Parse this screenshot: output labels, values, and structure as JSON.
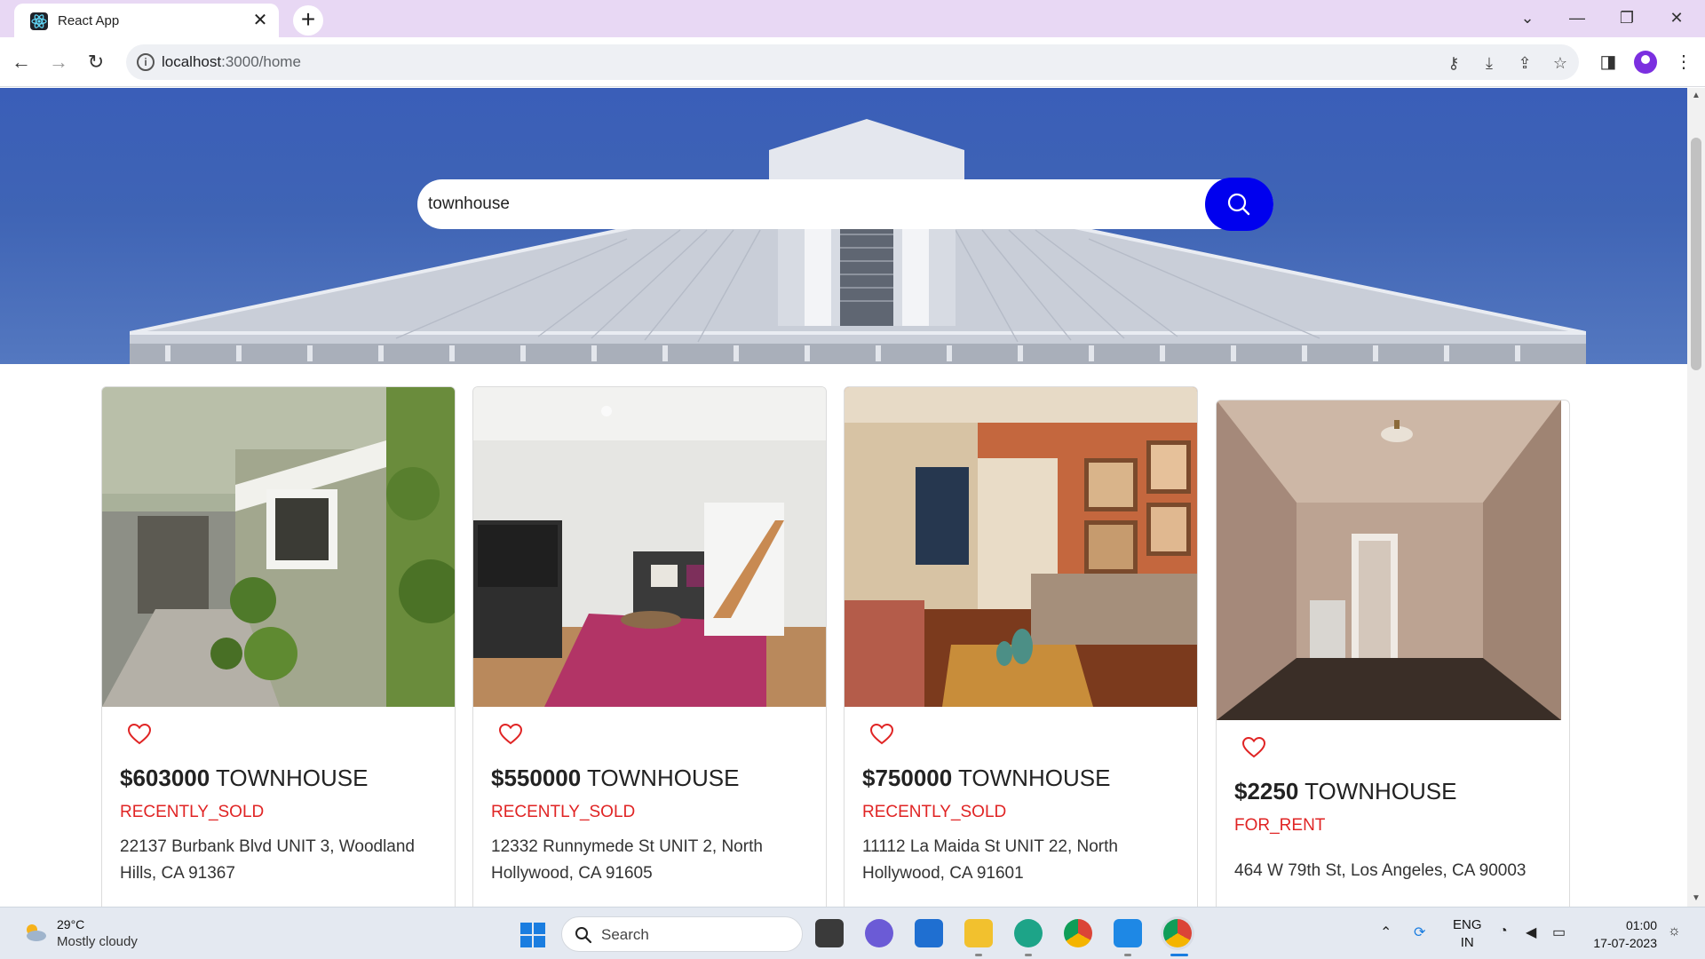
{
  "browser": {
    "tab_title": "React App",
    "url_host": "localhost",
    "url_rest": ":3000/home"
  },
  "search": {
    "value": "townhouse"
  },
  "listings": [
    {
      "price": "$603000",
      "type": "TOWNHOUSE",
      "status": "RECENTLY_SOLD",
      "address": "22137 Burbank Blvd UNIT 3, Woodland Hills, CA 91367"
    },
    {
      "price": "$550000",
      "type": "TOWNHOUSE",
      "status": "RECENTLY_SOLD",
      "address": "12332 Runnymede St UNIT 2, North Hollywood, CA 91605"
    },
    {
      "price": "$750000",
      "type": "TOWNHOUSE",
      "status": "RECENTLY_SOLD",
      "address": "11112 La Maida St UNIT 22, North Hollywood, CA 91601"
    },
    {
      "price": "$2250",
      "type": "TOWNHOUSE",
      "status": "FOR_RENT",
      "address": "464 W 79th St, Los Angeles, CA 90003"
    }
  ],
  "taskbar": {
    "weather_temp": "29°C",
    "weather_desc": "Mostly cloudy",
    "search_label": "Search",
    "lang_line1": "ENG",
    "lang_line2": "IN",
    "time": "01:00",
    "date": "17-07-2023"
  },
  "colors": {
    "accent_button": "#0000ee",
    "status_red": "#e02424",
    "tabstrip": "#e8d8f4"
  }
}
